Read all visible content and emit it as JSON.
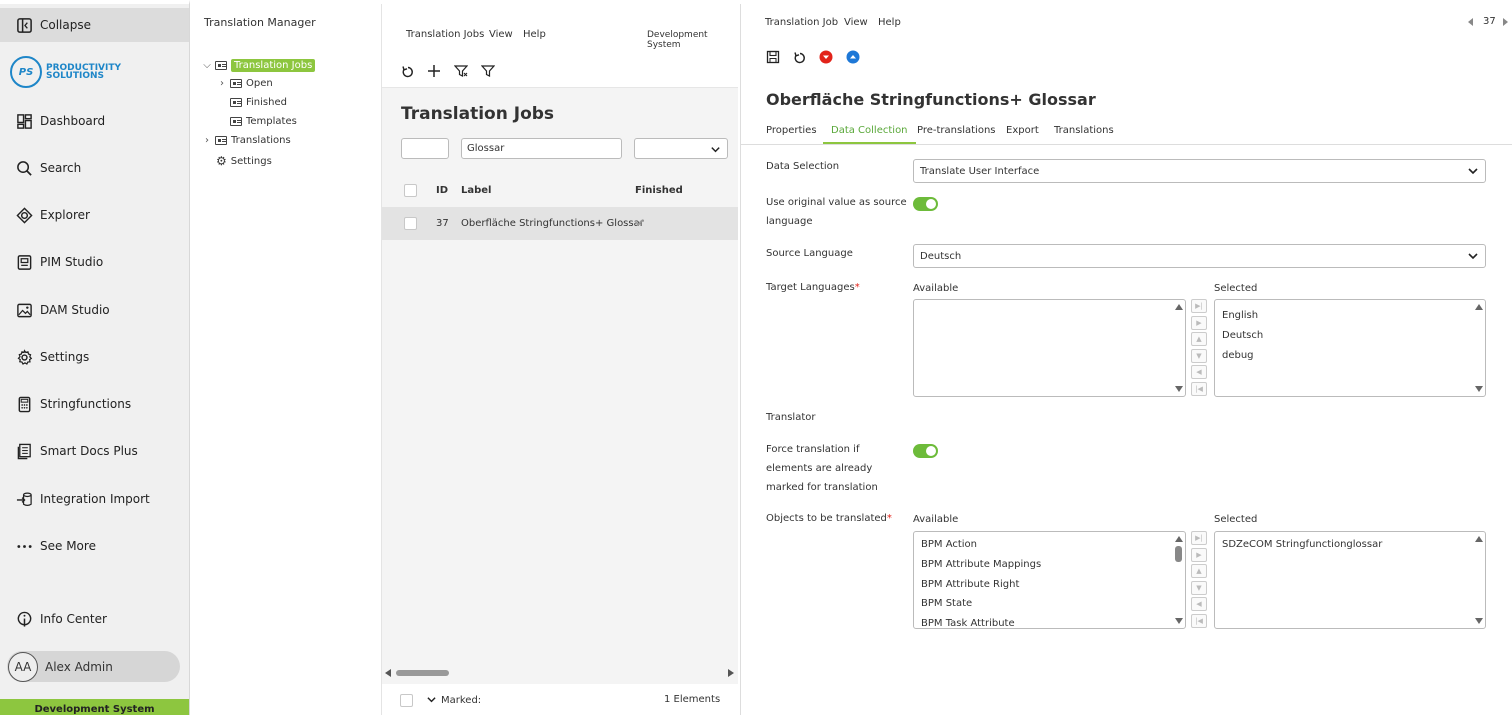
{
  "nav": {
    "collapse": "Collapse",
    "logo_initials": "PS",
    "logo_line1": "PRODUCTIVITY",
    "logo_line2": "SOLUTIONS",
    "items": [
      {
        "label": "Dashboard",
        "icon": "dashboard-icon"
      },
      {
        "label": "Search",
        "icon": "search-icon"
      },
      {
        "label": "Explorer",
        "icon": "explorer-icon"
      },
      {
        "label": "PIM Studio",
        "icon": "pim-studio-icon"
      },
      {
        "label": "DAM Studio",
        "icon": "image-icon"
      },
      {
        "label": "Settings",
        "icon": "gear-icon"
      },
      {
        "label": "Stringfunctions",
        "icon": "calculator-icon"
      },
      {
        "label": "Smart Docs Plus",
        "icon": "document-icon"
      },
      {
        "label": "Integration Import",
        "icon": "import-icon"
      },
      {
        "label": "See More",
        "icon": "more-icon"
      },
      {
        "label": "Info Center",
        "icon": "info-icon"
      }
    ],
    "user_initials": "AA",
    "user_name": "Alex Admin",
    "system_label": "Development System"
  },
  "tree": {
    "title": "Translation Manager",
    "nodes": [
      {
        "label": "Translation Jobs"
      },
      {
        "label": "Open"
      },
      {
        "label": "Finished"
      },
      {
        "label": "Templates"
      },
      {
        "label": "Translations"
      },
      {
        "label": "Settings"
      }
    ]
  },
  "jobs": {
    "menu": [
      "Translation Jobs",
      "View",
      "Help"
    ],
    "system": "Development System",
    "title": "Translation Jobs",
    "filter_id": "",
    "filter_label": "Glossar",
    "columns": {
      "id": "ID",
      "label": "Label",
      "finished": "Finished"
    },
    "rows": [
      {
        "id": "37",
        "label": "Oberfläche Stringfunctions+ Glossar",
        "finished": "✔"
      }
    ],
    "marked_label": "Marked:",
    "count_label": "1 Elements"
  },
  "detail": {
    "menu": [
      "Translation Job",
      "View",
      "Help"
    ],
    "record_number": "37",
    "title": "Oberfläche Stringfunctions+ Glossar",
    "tabs": [
      "Properties",
      "Data Collection",
      "Pre-translations",
      "Export",
      "Translations"
    ],
    "active_tab": "Data Collection",
    "fields": {
      "data_selection_label": "Data Selection",
      "data_selection_value": "Translate User Interface",
      "use_original_label_1": "Use original value as source",
      "use_original_label_2": "language",
      "use_original_on": true,
      "source_language_label": "Source Language",
      "source_language_value": "Deutsch",
      "target_languages_label": "Target Languages",
      "available_label": "Available",
      "selected_label": "Selected",
      "target_available": [],
      "target_selected": [
        "English",
        "Deutsch",
        "debug"
      ],
      "translator_label": "Translator",
      "force_label_1": "Force translation if",
      "force_label_2": "elements are already",
      "force_label_3": "marked for translation",
      "force_on": true,
      "objects_label": "Objects to be translated",
      "objects_available": [
        "BPM Action",
        "BPM Attribute Mappings",
        "BPM Attribute Right",
        "BPM State",
        "BPM Task Attribute"
      ],
      "objects_selected": [
        "SDZeCOM Stringfunctionglossar"
      ],
      "required_mark": "*"
    }
  },
  "colors": {
    "accent": "#8dc63f",
    "brand_blue": "#1e86c8",
    "danger": "#e2231a"
  }
}
